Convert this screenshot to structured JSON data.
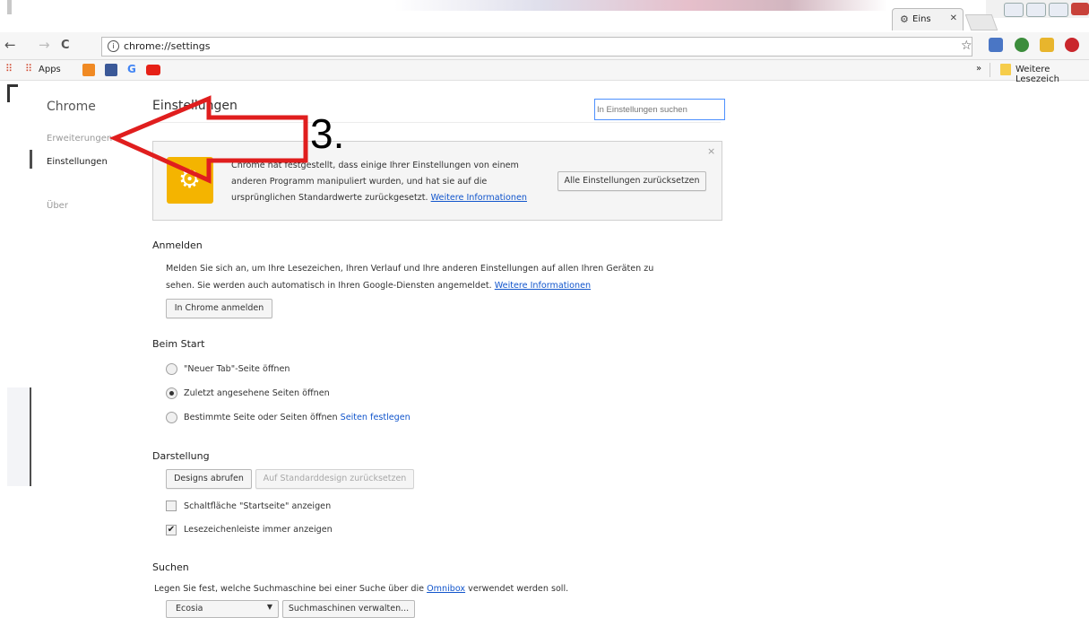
{
  "window": {
    "tab_title": "Eins",
    "tab_icon": "gear-icon"
  },
  "toolbar": {
    "back": "←",
    "forward": "→",
    "reload": "C",
    "url": "chrome://settings",
    "bookmark_star": "☆"
  },
  "bookmarks": {
    "apps_label": "Apps",
    "more": "»",
    "folder_label": "Weitere Lesezeich"
  },
  "sidebar": {
    "title": "Chrome",
    "items": [
      {
        "label": "Erweiterungen"
      },
      {
        "label": "Einstellungen"
      },
      {
        "label": "Über"
      }
    ]
  },
  "settings": {
    "title": "Einstellungen",
    "search_placeholder": "In Einstellungen suchen",
    "banner": {
      "line1": "Chrome hat festgestellt, dass einige Ihrer Einstellungen von einem",
      "line2": "anderen Programm manipuliert wurden, und hat sie auf die",
      "line3": "ursprünglichen Standardwerte zurückgesetzt.",
      "link": "Weitere Informationen",
      "reset_button": "Alle Einstellungen zurücksetzen",
      "close": "×"
    },
    "signin": {
      "heading": "Anmelden",
      "line1": "Melden Sie sich an, um Ihre Lesezeichen, Ihren Verlauf und Ihre anderen Einstellungen auf allen Ihren Geräten zu",
      "line2": "sehen. Sie werden auch automatisch in Ihren Google-Diensten angemeldet.",
      "link": "Weitere Informationen",
      "button": "In Chrome anmelden"
    },
    "startup": {
      "heading": "Beim Start",
      "options": [
        {
          "label": "\"Neuer Tab\"-Seite öffnen",
          "selected": false
        },
        {
          "label": "Zuletzt angesehene Seiten öffnen",
          "selected": true
        },
        {
          "label": "Bestimmte Seite oder Seiten öffnen",
          "selected": false
        }
      ],
      "set_pages_link": "Seiten festlegen"
    },
    "appearance": {
      "heading": "Darstellung",
      "get_themes": "Designs abrufen",
      "reset_theme": "Auf Standarddesign zurücksetzen",
      "home_button_label": "Schaltfläche \"Startseite\" anzeigen",
      "home_button_checked": false,
      "bookmarks_bar_label": "Lesezeichenleiste immer anzeigen",
      "bookmarks_bar_checked": true
    },
    "search": {
      "heading": "Suchen",
      "line_pre": "Legen Sie fest, welche Suchmaschine bei einer Suche über die",
      "omnibox_link": "Omnibox",
      "line_post": "verwendet werden soll.",
      "engine_selected": "Ecosia",
      "manage_button": "Suchmaschinen verwalten..."
    }
  },
  "annotation": {
    "number": "3.",
    "arrow_color": "#e01e1e"
  }
}
